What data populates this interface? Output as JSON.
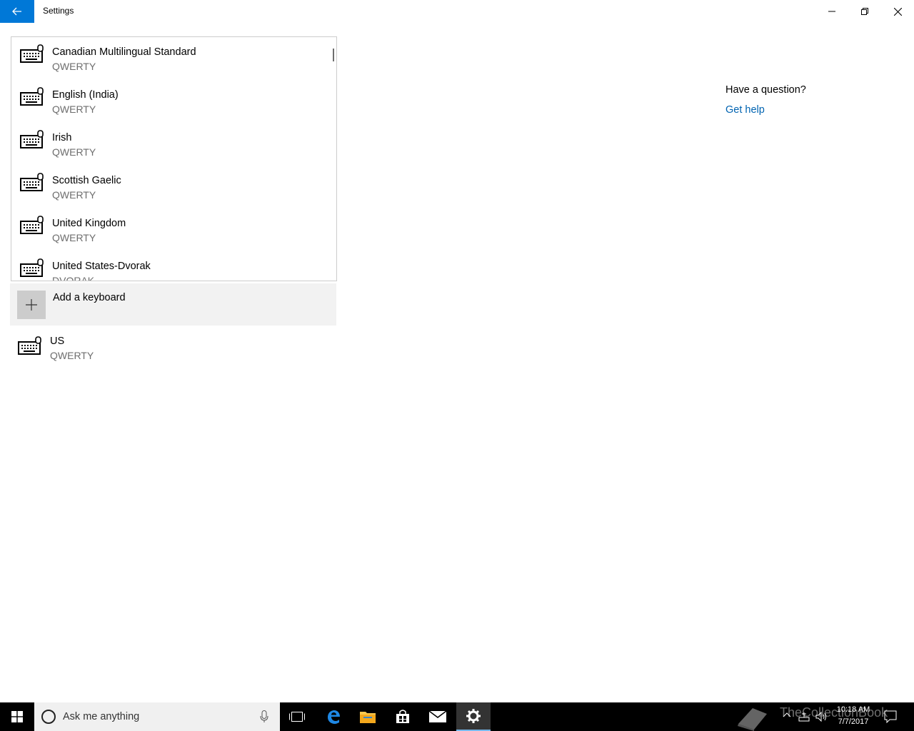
{
  "window": {
    "title": "Settings",
    "accent": "#0078d7"
  },
  "keyboard_list": [
    {
      "name": "Canadian Multilingual Standard",
      "layout": "QWERTY"
    },
    {
      "name": "English (India)",
      "layout": "QWERTY"
    },
    {
      "name": "Irish",
      "layout": "QWERTY"
    },
    {
      "name": "Scottish Gaelic",
      "layout": "QWERTY"
    },
    {
      "name": "United Kingdom",
      "layout": "QWERTY"
    },
    {
      "name": "United States-Dvorak",
      "layout": "DVORAK"
    }
  ],
  "add_keyboard": {
    "label": "Add a keyboard"
  },
  "installed_keyboard": {
    "name": "US",
    "layout": "QWERTY"
  },
  "help": {
    "question": "Have a question?",
    "link": "Get help"
  },
  "taskbar": {
    "search_placeholder": "Ask me anything",
    "time": "10:18 AM",
    "date": "7/7/2017",
    "watermark": "TheCollectionBook"
  }
}
